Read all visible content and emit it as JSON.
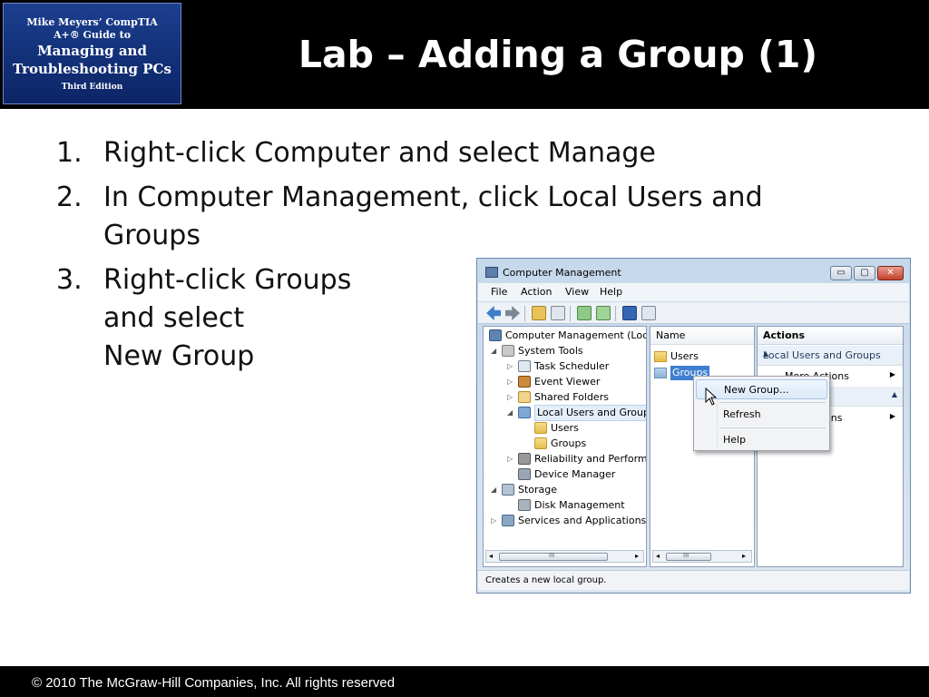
{
  "book": {
    "line1": "Mike Meyers’ CompTIA",
    "line2": "A+® Guide to",
    "line3": "Managing and",
    "line4": "Troubleshooting PCs",
    "line5": "Third Edition"
  },
  "slide": {
    "title": "Lab – Adding a Group (1)",
    "steps": [
      {
        "num": "1.",
        "text": "Right-click Computer and select Manage"
      },
      {
        "num": "2.",
        "text": "In Computer Management, click Local Users and Groups"
      },
      {
        "num": "3.",
        "lines": [
          "Right-click Groups",
          "and select",
          "New Group"
        ]
      }
    ]
  },
  "window": {
    "title": "Computer Management",
    "buttons": {
      "minimize": "▭",
      "maximize": "▢",
      "close": "✕"
    },
    "menu": [
      "File",
      "Action",
      "View",
      "Help"
    ],
    "tree": [
      {
        "label": "Computer Management (Local",
        "expander": "",
        "icon": "computer-icon"
      },
      {
        "label": "System Tools",
        "expander": "◢",
        "icon": "tools-icon"
      },
      {
        "label": "Task Scheduler",
        "expander": "▷",
        "icon": "clock-icon"
      },
      {
        "label": "Event Viewer",
        "expander": "▷",
        "icon": "event-viewer-icon"
      },
      {
        "label": "Shared Folders",
        "expander": "▷",
        "icon": "shared-folders-icon"
      },
      {
        "label": "Local Users and Groups",
        "expander": "◢",
        "icon": "users-icon"
      },
      {
        "label": "Users",
        "expander": "",
        "icon": "folder-icon"
      },
      {
        "label": "Groups",
        "expander": "",
        "icon": "folder-icon"
      },
      {
        "label": "Reliability and Performa",
        "expander": "▷",
        "icon": "reliability-icon"
      },
      {
        "label": "Device Manager",
        "expander": "",
        "icon": "device-manager-icon"
      },
      {
        "label": "Storage",
        "expander": "◢",
        "icon": "storage-icon"
      },
      {
        "label": "Disk Management",
        "expander": "",
        "icon": "disk-icon"
      },
      {
        "label": "Services and Applications",
        "expander": "▷",
        "icon": "services-icon"
      }
    ],
    "list": {
      "header": "Name",
      "rows": [
        {
          "label": "Users"
        },
        {
          "label": "Groups"
        }
      ]
    },
    "actions": {
      "header": "Actions",
      "section1": "Local Users and Groups",
      "item1": "More Actions",
      "item2": "ons"
    },
    "context_menu": [
      "New Group...",
      "Refresh",
      "Help"
    ],
    "status": "Creates a new local group.",
    "scroll_grip": "III",
    "arrow_left": "◂",
    "arrow_right": "▸",
    "caret_up": "▲",
    "caret_right": "▶"
  },
  "footer": {
    "copyright": "© 2010 The McGraw-Hill Companies, Inc. All rights reserved"
  },
  "colors": {
    "header_bg": "#000000",
    "book_blue": "#123078",
    "selection": "#3f7fd1"
  }
}
